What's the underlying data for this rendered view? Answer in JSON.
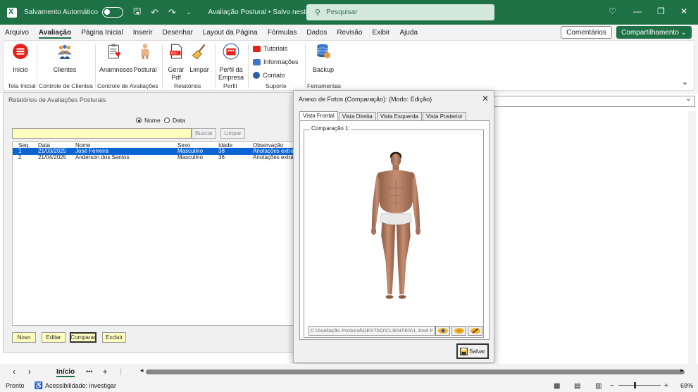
{
  "titlebar": {
    "autosave_label": "Salvamento Automático",
    "doc_title": "Avaliação Postural • Salvo neste PC ⌄",
    "search_placeholder": "Pesquisar"
  },
  "menu": {
    "tabs": [
      "Arquivo",
      "Avaliação",
      "Página Inicial",
      "Inserir",
      "Desenhar",
      "Layout da Página",
      "Fórmulas",
      "Dados",
      "Revisão",
      "Exibir",
      "Ajuda"
    ],
    "active": "Avaliação",
    "comments_label": "Comentários",
    "share_label": "Compartilhamento ⌄"
  },
  "ribbon": {
    "inicio": "Início",
    "clientes": "Clientes",
    "anamneses": "Anamneses",
    "postural": "Postural",
    "gerar_pdf_1": "Gerar",
    "gerar_pdf_2": "Pdf",
    "limpar": "Limpar",
    "perfil_1": "Perfil da",
    "perfil_2": "Empresa",
    "tutoriais": "Tutoriais",
    "informacoes": "Informações",
    "contato": "Contato",
    "backup": "Backup",
    "groups": {
      "tela_inicial": "Tela Inicial",
      "controle_clientes": "Controle de Clientes",
      "controle_avaliacoes": "Controle de Avaliações",
      "relatorios": "Relatórios",
      "perfil": "Perfil",
      "suporte": "Suporte",
      "ferramentas": "Ferramentas"
    }
  },
  "report_form": {
    "title": "Relatórios de Avaliações Posturais",
    "radio_nome": "Nome",
    "radio_data": "Data",
    "search_value": "",
    "buscar": "Buscar",
    "limpar": "Limpar",
    "columns": [
      "Seq.",
      "Data",
      "Nome",
      "Sexo",
      "Idade",
      "Observação"
    ],
    "rows": [
      {
        "seq": "1",
        "data": "21/03/2025",
        "nome": "José Ferreira",
        "sexo": "Masculino",
        "idade": "38",
        "obs": "Anotações extra"
      },
      {
        "seq": "2",
        "data": "21/04/2025",
        "nome": "Anderson dos Santos",
        "sexo": "Masculino",
        "idade": "36",
        "obs": "Anotações extra"
      }
    ],
    "buttons": {
      "novo": "Novo",
      "editar": "Editar",
      "comparar": "Comparar",
      "excluir": "Excluir"
    }
  },
  "photo_dialog": {
    "title": "Anexo de Fotos (Comparação): (Modo: Edição)",
    "tabs": [
      "Vista Frontal",
      "Vista Direita",
      "Vista Esquerda",
      "Vista Posterior"
    ],
    "active_tab": "Vista Frontal",
    "frame_label": "Comparação 1:",
    "path": "C:\\Avaliação Postural\\GESTAO\\CLIENTES\\1.José F",
    "save_label": "Salvar"
  },
  "sheet_tabs": {
    "active": "Início",
    "more": "•••",
    "add": "+"
  },
  "status": {
    "ready": "Pronto",
    "accessibility": "Acessibilidade: investigar",
    "zoom": "69%"
  },
  "colors": {
    "brand_green": "#1e7145",
    "selection_blue": "#0a64d2",
    "input_yellow": "#ffffc0"
  }
}
